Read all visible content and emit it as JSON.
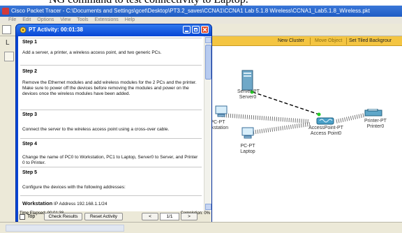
{
  "doc_text": "NG command to test connectivity to Laptop.",
  "window": {
    "title": "Cisco Packet Tracer - C:\\Documents and Settings\\gcet\\Desktop\\PT3.2_saves\\CCNA1\\CCNA1 Lab 5.1.8 Wireless\\CCNA1_Lab5.1.8_Wireless.pkt",
    "menu": [
      "File",
      "Edit",
      "Options",
      "View",
      "Tools",
      "Extensions",
      "Help"
    ]
  },
  "left_strip": {
    "label": "L"
  },
  "logical_bar": {
    "new_cluster": "New Cluster",
    "move_object": "Move Object",
    "set_tiled": "Set Tiled Backgrour"
  },
  "devices": {
    "server": {
      "type": "Server-PT",
      "name": "Server0"
    },
    "workstation": {
      "type": "PC-PT",
      "name": "orkstation"
    },
    "laptop": {
      "type": "PC-PT",
      "name": "Laptop"
    },
    "access_point": {
      "type": "AccessPoint-PT",
      "name": "Access Point0"
    },
    "printer": {
      "type": "Printer-PT",
      "name": "Printer0"
    }
  },
  "activity": {
    "title": "PT Activity: 00:01:38",
    "steps": [
      {
        "heading": "Step 1",
        "text": "Add a server, a printer, a wireless access point, and two generic PCs."
      },
      {
        "heading": "Step 2",
        "text": "Remove the Ethernet modules and add wireless modules for the 2 PCs and the printer. Make sure to power off the devices before removing the modules and power on the devices once the wireless modules have been added."
      },
      {
        "heading": "Step 3",
        "text": "Connect the server to the wireless access point using a cross-over cable."
      },
      {
        "heading": "Step 4",
        "text": "Change the name of PC0 to Workstation, PC1 to Laptop, Server0 to Server, and Printer 0 to Printer."
      },
      {
        "heading": "Step 5",
        "text": "Configure the devices with the following addresses:"
      }
    ],
    "partial": {
      "name": "Workstation",
      "text": "IP Address 192.168.1.1/24"
    },
    "time_elapsed": "Time Elapsed: 00:01:38",
    "completion": "Completion: 0%",
    "top_label": "Top",
    "check_results": "Check Results",
    "reset_activity": "Reset Activity",
    "prev": "<",
    "page": "1/1",
    "next": ">"
  },
  "colors": {
    "xp_blue": "#0a46d4",
    "logical_yellow": "#f4c542",
    "cable": "#000000",
    "link_led": "#22cc22"
  }
}
